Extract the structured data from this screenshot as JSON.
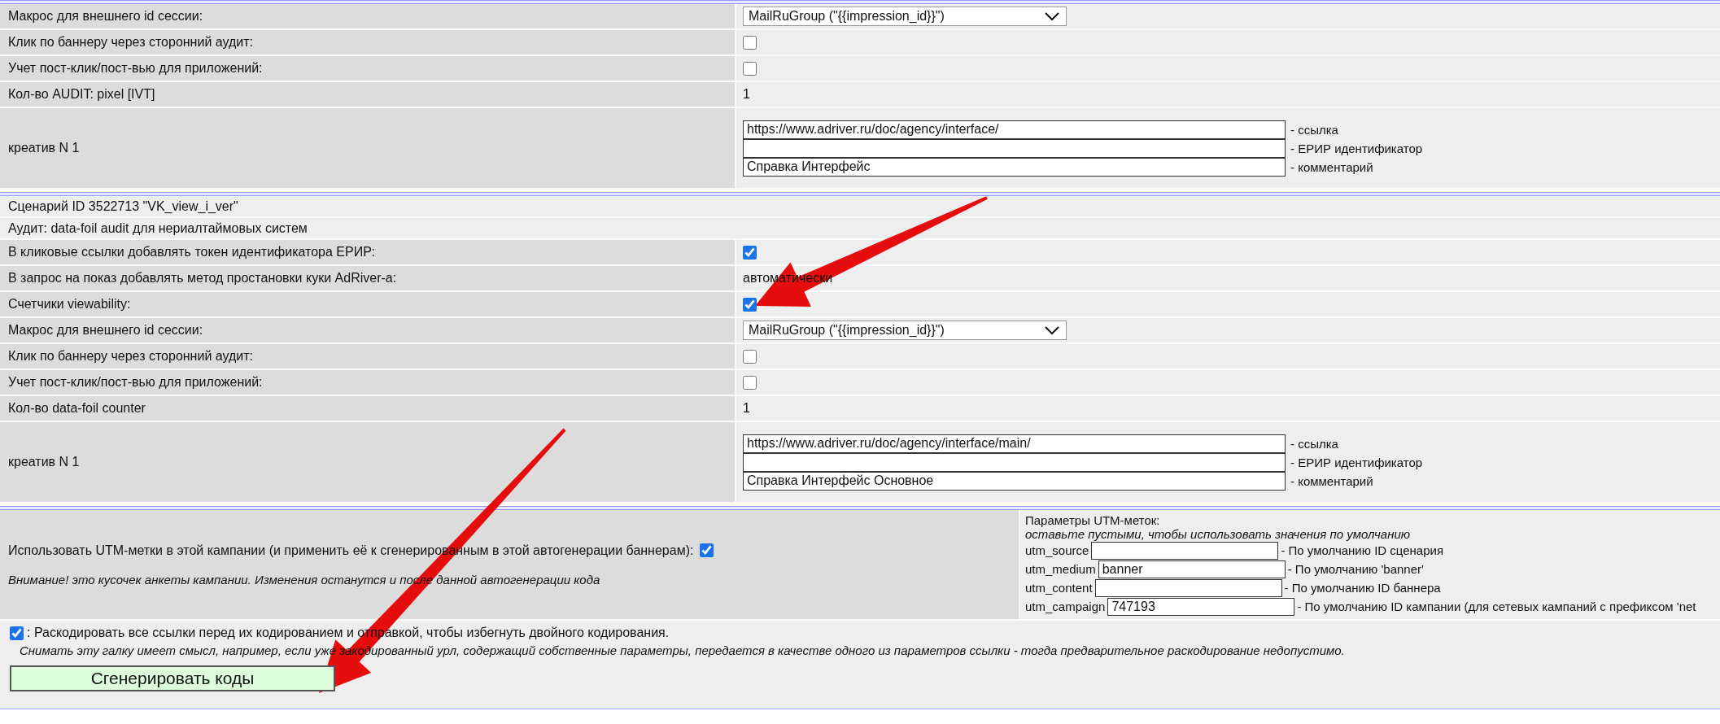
{
  "section_1": {
    "rows": [
      {
        "kind": "select",
        "label": "Макрос для внешнего id сессии:",
        "value": "MailRuGroup (\"{{impression_id}}\")"
      },
      {
        "kind": "checkbox",
        "label": "Клик по баннеру через сторонний аудит:",
        "checked": false
      },
      {
        "kind": "checkbox",
        "label": "Учет пост-клик/пост-вью для приложений:",
        "checked": false
      },
      {
        "kind": "text",
        "label": "Кол-во AUDIT: pixel [IVT]",
        "value": "1"
      },
      {
        "kind": "creative",
        "label": "креатив N 1",
        "fields": [
          {
            "value": "https://www.adriver.ru/doc/agency/interface/",
            "caption": "- ссылка"
          },
          {
            "caption": "- ЕРИР идентификатор"
          },
          {
            "value": "Справка Интерфейс",
            "caption": "- комментарий"
          }
        ]
      }
    ]
  },
  "section_2": {
    "title": "Сценарий ID 3522713 \"VK_view_i_ver\"",
    "audit": "Аудит: data-foil audit для нериалтаймовых систем",
    "rows": [
      {
        "kind": "checkbox",
        "label": "В кликовые ссылки добавлять токен идентификатора ЕРИР:",
        "checked": true
      },
      {
        "kind": "text",
        "label": "В запрос на показ добавлять метод простановки куки AdRiver-а:",
        "value": "автоматически"
      },
      {
        "kind": "checkbox",
        "label": "Счетчики viewability:",
        "checked": true
      },
      {
        "kind": "select",
        "label": "Макрос для внешнего id сессии:",
        "value": "MailRuGroup (\"{{impression_id}}\")"
      },
      {
        "kind": "checkbox",
        "label": "Клик по баннеру через сторонний аудит:",
        "checked": false
      },
      {
        "kind": "checkbox",
        "label": "Учет пост-клик/пост-вью для приложений:",
        "checked": false
      },
      {
        "kind": "text",
        "label": "Кол-во data-foil counter",
        "value": "1"
      },
      {
        "kind": "creative",
        "label": "креатив N 1",
        "fields": [
          {
            "value": "https://www.adriver.ru/doc/agency/interface/main/",
            "caption": "- ссылка"
          },
          {
            "caption": "- ЕРИР идентификатор"
          },
          {
            "value": "Справка Интерфейс Основное",
            "caption": "- комментарий"
          }
        ]
      }
    ]
  },
  "utm": {
    "label": "Использовать UTM-метки в этой кампании (и применить её к сгенерированным в этой автогенерации баннерам):",
    "checked": true,
    "note": "Внимание! это кусочек анкеты кампании. Изменения останутся и после данной автогенерации кода",
    "params_title": "Параметры UTM-меток:",
    "params_hint": "оставьте пустыми, чтобы использовать значения по умолчанию",
    "params": [
      {
        "name": "utm_source",
        "hint": "- По умолчанию ID сценария"
      },
      {
        "name": "utm_medium",
        "value": "banner",
        "hint": "- По умолчанию 'banner'"
      },
      {
        "name": "utm_content",
        "hint": "- По умолчанию ID баннера"
      },
      {
        "name": "utm_campaign",
        "value": "747193",
        "hint": "- По умолчанию ID кампании (для сетевых кампаний с префиксом 'net"
      }
    ]
  },
  "decode": {
    "checked": true,
    "label": ": Раскодировать все ссылки перед их кодированием и отправкой, чтобы избегнуть двойного кодирования.",
    "note": "Снимать эту галку имеет смысл, например, если уже закодированный урл, содержащий собственные параметры, передается в качестве одного из параметров ссылки - тогда предварительное раскодирование недопустимо."
  },
  "generate_button": "Сгенерировать коды",
  "annotations": [
    {
      "kind": "arrow"
    },
    {
      "kind": "arrow"
    }
  ]
}
